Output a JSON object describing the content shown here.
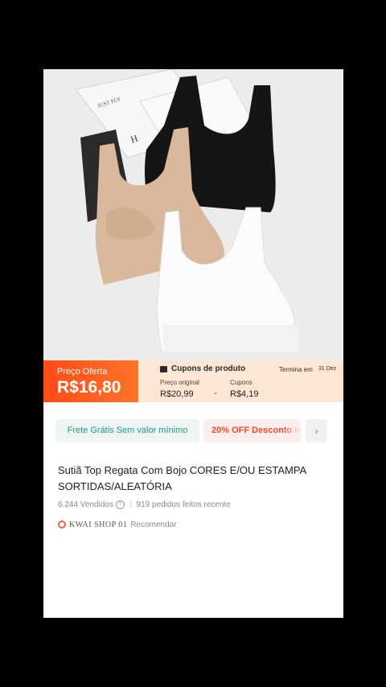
{
  "promo": {
    "offer_label": "Preço Oferta",
    "offer_price": "R$16,80",
    "coupons_title": "Cupons de produto",
    "ends_label": "Termina em",
    "ends_date": "31 Dez",
    "original_label": "Preço original",
    "original_price": "R$20,99",
    "minus": "-",
    "coupon_label": "Cupons",
    "coupon_value": "R$4,19"
  },
  "chips": {
    "free_shipping": "Frete Grátis Sem valor mínimo",
    "discount": "20% OFF Desconto m",
    "more_icon": "›"
  },
  "product": {
    "title": "Sutiã Top Regata Com Bojo CORES E/OU ESTAMPA SORTIDAS/ALEATÓRIA",
    "sold": "6.244 Vendidos",
    "info_icon": "?",
    "separator": "|",
    "orders": "919 pedidos feitos recente",
    "shop_name": "KWAI SHOP 01",
    "shop_action": "Recomendar"
  },
  "image_text": {
    "magazine_top": "JUST FLY",
    "magazine_letter": "H"
  },
  "colors": {
    "accent": "#ff4a19",
    "coupon_bg": "#fde7d4",
    "free_shipping": "#1f9b7c",
    "discount": "#f04a2a"
  }
}
